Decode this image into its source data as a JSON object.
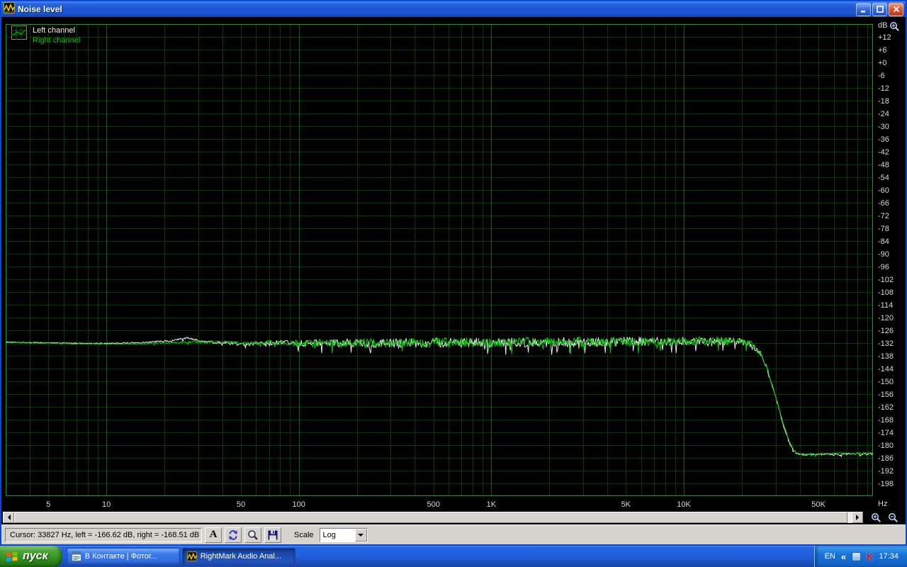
{
  "window": {
    "title": "Noise level"
  },
  "legend": {
    "left_label": "Left channel",
    "right_label": "Right channel"
  },
  "chart_data": {
    "type": "line",
    "title": "Noise level",
    "xlabel": "Hz",
    "ylabel": "dB",
    "x_scale": "log",
    "xlim": [
      3,
      96000
    ],
    "ylim": [
      -204,
      18
    ],
    "grid_step_db": 6,
    "legend_position": "top-left",
    "colors": {
      "plot_bg": "#000000",
      "grid": "#003d00",
      "grid_major": "#006600",
      "frame": "#00a800",
      "left_channel": "#ebebeb",
      "right_channel": "#00cc00"
    },
    "y_ticks": [
      "+12",
      "+6",
      "+0",
      "-6",
      "-12",
      "-18",
      "-24",
      "-30",
      "-36",
      "-42",
      "-48",
      "-54",
      "-60",
      "-66",
      "-72",
      "-78",
      "-84",
      "-90",
      "-96",
      "-102",
      "-108",
      "-114",
      "-120",
      "-126",
      "-132",
      "-138",
      "-144",
      "-150",
      "-156",
      "-162",
      "-168",
      "-174",
      "-180",
      "-186",
      "-192",
      "-198"
    ],
    "x_ticks": [
      {
        "label": "5",
        "f": 5
      },
      {
        "label": "10",
        "f": 10
      },
      {
        "label": "50",
        "f": 50
      },
      {
        "label": "100",
        "f": 100
      },
      {
        "label": "500",
        "f": 500
      },
      {
        "label": "1K",
        "f": 1000
      },
      {
        "label": "5K",
        "f": 5000
      },
      {
        "label": "10K",
        "f": 10000
      },
      {
        "label": "50K",
        "f": 50000
      }
    ],
    "series": [
      {
        "name": "Left channel",
        "color": "#ebebeb",
        "points": [
          [
            3,
            -131.5
          ],
          [
            8,
            -132.2
          ],
          [
            15,
            -131.8
          ],
          [
            22,
            -130.8
          ],
          [
            27,
            -129.6
          ],
          [
            32,
            -131.5
          ],
          [
            40,
            -131.8
          ],
          [
            55,
            -132.6
          ],
          [
            70,
            -131.8
          ],
          [
            100,
            -132.1
          ],
          [
            200,
            -131.9
          ],
          [
            500,
            -131.8
          ],
          [
            1000,
            -131.7
          ],
          [
            2000,
            -131.5
          ],
          [
            5000,
            -131.3
          ],
          [
            10000,
            -131.1
          ],
          [
            15000,
            -131.0
          ],
          [
            20000,
            -131.4
          ],
          [
            22500,
            -132.6
          ],
          [
            25000,
            -137
          ],
          [
            27000,
            -144
          ],
          [
            29000,
            -153
          ],
          [
            31000,
            -162
          ],
          [
            33000,
            -171
          ],
          [
            35000,
            -178
          ],
          [
            37000,
            -182.5
          ],
          [
            39000,
            -184.3
          ],
          [
            45000,
            -184.4
          ],
          [
            96000,
            -184.0
          ]
        ],
        "noise": [
          [
            3,
            0.15
          ],
          [
            15,
            0.3
          ],
          [
            25,
            0.5
          ],
          [
            50,
            0.7
          ],
          [
            80,
            1.2
          ],
          [
            120,
            1.8
          ],
          [
            300,
            2.2
          ],
          [
            1000,
            2.3
          ],
          [
            5000,
            2.2
          ],
          [
            15000,
            2.0
          ],
          [
            21000,
            1.6
          ],
          [
            25000,
            1.0
          ],
          [
            30000,
            0.6
          ],
          [
            40000,
            0.5
          ],
          [
            96000,
            0.5
          ]
        ]
      },
      {
        "name": "Right channel",
        "color": "#00cc00",
        "points": [
          [
            3,
            -131.7
          ],
          [
            8,
            -132.4
          ],
          [
            15,
            -132.4
          ],
          [
            25,
            -131.6
          ],
          [
            40,
            -131.4
          ],
          [
            55,
            -132.2
          ],
          [
            70,
            -131.6
          ],
          [
            100,
            -131.9
          ],
          [
            300,
            -131.7
          ],
          [
            1000,
            -131.5
          ],
          [
            3000,
            -131.3
          ],
          [
            10000,
            -131.0
          ],
          [
            15000,
            -130.9
          ],
          [
            20000,
            -131.3
          ],
          [
            22500,
            -132.4
          ],
          [
            25000,
            -136.5
          ],
          [
            27000,
            -143.5
          ],
          [
            29000,
            -152.5
          ],
          [
            31000,
            -161.5
          ],
          [
            33000,
            -170.5
          ],
          [
            35000,
            -177.5
          ],
          [
            37000,
            -182.2
          ],
          [
            39000,
            -184.1
          ],
          [
            45000,
            -184.2
          ],
          [
            96000,
            -183.8
          ]
        ],
        "noise": [
          [
            3,
            0.15
          ],
          [
            15,
            0.3
          ],
          [
            25,
            0.5
          ],
          [
            50,
            0.7
          ],
          [
            80,
            1.2
          ],
          [
            120,
            1.8
          ],
          [
            300,
            2.2
          ],
          [
            1000,
            2.3
          ],
          [
            5000,
            2.2
          ],
          [
            15000,
            2.0
          ],
          [
            21000,
            1.6
          ],
          [
            25000,
            1.0
          ],
          [
            30000,
            0.6
          ],
          [
            40000,
            0.5
          ],
          [
            96000,
            0.5
          ]
        ]
      }
    ]
  },
  "statusbar": {
    "cursor_text": "Cursor:  33827 Hz,  left = -166.62 dB,  right = -168.51 dB",
    "font_button_label": "A",
    "scale_label": "Scale",
    "scale_value": "Log"
  },
  "taskbar": {
    "start_label": "пуск",
    "tasks": [
      {
        "label": "В Контакте | Фотог...",
        "active": false
      },
      {
        "label": "RightMark Audio Anal...",
        "active": true
      }
    ],
    "tray": {
      "language": "EN",
      "clock": "17:34"
    }
  }
}
